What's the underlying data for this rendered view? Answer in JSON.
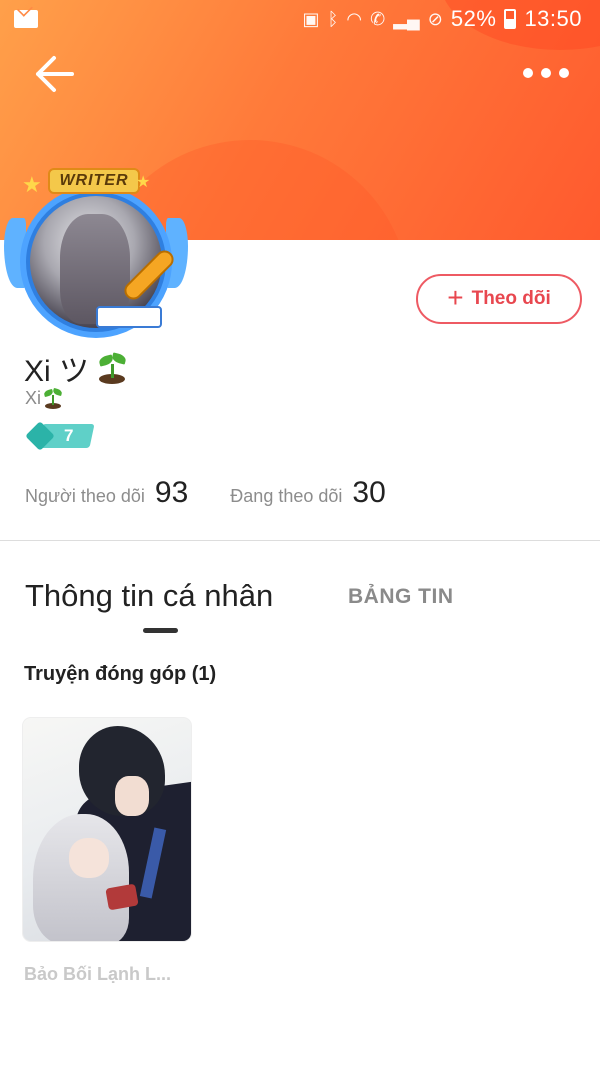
{
  "status_bar": {
    "battery_percent": "52%",
    "time": "13:50",
    "icons": [
      "mail-icon",
      "sim-icon",
      "bluetooth-icon",
      "wifi-icon",
      "call-icon",
      "signal-icon",
      "do-not-disturb-icon",
      "battery-icon"
    ]
  },
  "header": {
    "gradient_colors": [
      "#ffa04a",
      "#ff5a2e"
    ]
  },
  "avatar": {
    "badge_text": "WRITER"
  },
  "follow_button": {
    "label": "Theo dõi",
    "accent_color": "#e8474f"
  },
  "profile": {
    "display_name": "Xi ツ",
    "username": "Xi",
    "level": "7"
  },
  "stats": {
    "followers_label": "Người theo dõi",
    "followers_count": "93",
    "following_label": "Đang theo dõi",
    "following_count": "30"
  },
  "tabs": {
    "personal_info": "Thông tin cá nhân",
    "news_feed": "BẢNG TIN",
    "active": "personal_info"
  },
  "contributions": {
    "section_title": "Truyện đóng góp (1)",
    "books": [
      {
        "title": "Bảo Bối Lạnh L..."
      }
    ]
  }
}
